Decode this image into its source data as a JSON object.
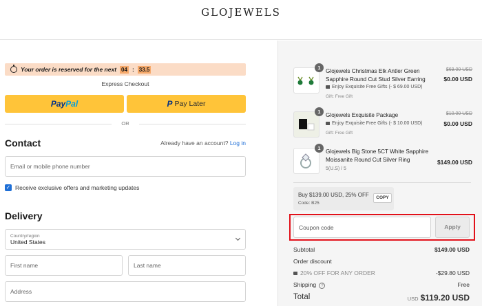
{
  "brand": {
    "logo": "GLOJEWELS"
  },
  "reservation": {
    "text": "Your order is reserved for the next",
    "minutes": "04",
    "separator": ":",
    "seconds": "33.5"
  },
  "express": {
    "label": "Express Checkout",
    "paypal_part1": "Pay",
    "paypal_part2": "Pal",
    "paylater_label": "Pay Later",
    "or": "OR"
  },
  "contact": {
    "heading": "Contact",
    "have_account": "Already have an account?",
    "login": "Log in",
    "email_placeholder": "Email or mobile phone number",
    "offers_label": "Receive exclusive offers and marketing updates"
  },
  "delivery": {
    "heading": "Delivery",
    "country_label": "Country/region",
    "country_value": "United States",
    "first_name": "First name",
    "last_name": "Last name",
    "address": "Address"
  },
  "items": [
    {
      "qty": "1",
      "name": "Glojewels Christmas Elk Antler Green Sapphire Round Cut Stud Silver Earring",
      "extra": "Enjoy Exquisite Free Gifts (- $ 69.00 USD)",
      "gift": "Gift: Free Gift",
      "old_price": "$69.00 USD",
      "price": "$0.00 USD"
    },
    {
      "qty": "1",
      "name": "Glojewels Exquisite Package",
      "extra": "Enjoy Exquisite Free Gifts (- $ 10.00 USD)",
      "gift": "Gift: Free Gift",
      "old_price": "$10.00 USD",
      "price": "$0.00 USD"
    },
    {
      "qty": "1",
      "name": "Glojewels Big Stone 5CT White Sapphire Moissanite Round Cut Silver Ring",
      "variant": "5(U.S) / 5",
      "price": "$149.00 USD"
    }
  ],
  "offer": {
    "text": "Buy $139.00 USD, 25% OFF",
    "code": "Code: B25",
    "copy_label": "COPY"
  },
  "coupon": {
    "placeholder": "Coupon code",
    "apply_label": "Apply"
  },
  "summary": {
    "subtotal_label": "Subtotal",
    "subtotal_value": "$149.00 USD",
    "order_discount_label": "Order discount",
    "discount_name": "20% OFF FOR ANY ORDER",
    "discount_value": "-$29.80 USD",
    "shipping_label": "Shipping",
    "shipping_value": "Free",
    "total_label": "Total",
    "total_currency": "USD",
    "total_value": "$119.20 USD"
  },
  "colors": {
    "accent": "#1f6fd6",
    "paypal_yellow": "#ffc439",
    "reserve_bg": "#fbdcc6",
    "highlight_red": "#e2111a"
  }
}
